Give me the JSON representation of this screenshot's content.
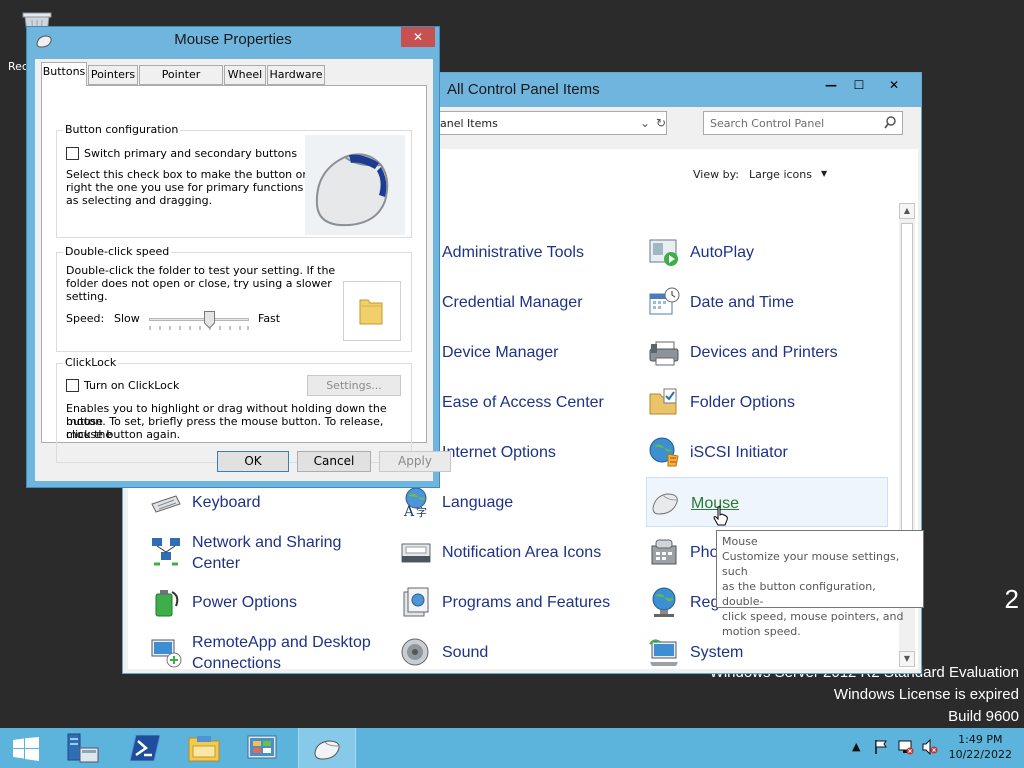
{
  "desktop": {
    "recycle_bin_label": "Rec",
    "watermark": {
      "edition_tail": "2",
      "edition": "Windows Server 2012 R2 Standard Evaluation",
      "license": "Windows License is expired",
      "build": "Build 9600"
    }
  },
  "control_panel": {
    "title": "All Control Panel Items",
    "caption_buttons": {
      "minimize": "—",
      "maximize": "☐",
      "close": "✕"
    },
    "address": "anel Items",
    "search_placeholder": "Search Control Panel",
    "view_by_label": "View by:",
    "view_by_value": "Large icons",
    "items": [
      {
        "label": "Administrative Tools",
        "icon": "admin-tools-icon"
      },
      {
        "label": "AutoPlay",
        "icon": "autoplay-icon"
      },
      {
        "label": "Credential Manager",
        "icon": "credential-manager-icon"
      },
      {
        "label": "Date and Time",
        "icon": "calendar-clock-icon"
      },
      {
        "label": "Device Manager",
        "icon": "device-manager-icon"
      },
      {
        "label": "Devices and Printers",
        "icon": "printer-icon"
      },
      {
        "label": "Ease of Access Center",
        "icon": "ease-of-access-icon"
      },
      {
        "label": "Folder Options",
        "icon": "folder-options-icon"
      },
      {
        "label": "Internet Options",
        "icon": "internet-options-icon"
      },
      {
        "label": "iSCSI Initiator",
        "icon": "iscsi-globe-icon"
      },
      {
        "label": "Keyboard",
        "icon": "keyboard-icon"
      },
      {
        "label": "Language",
        "icon": "language-icon"
      },
      {
        "label": "Mouse",
        "icon": "mouse-icon"
      },
      {
        "label_line1": "Network and Sharing",
        "label_line2": "Center",
        "icon": "network-icon"
      },
      {
        "label": "Notification Area Icons",
        "icon": "notification-area-icon"
      },
      {
        "label": "Pho",
        "icon": "phone-modem-icon"
      },
      {
        "label": "Power Options",
        "icon": "power-options-icon"
      },
      {
        "label": "Programs and Features",
        "icon": "programs-features-icon"
      },
      {
        "label": "Reg",
        "icon": "region-globe-icon"
      },
      {
        "label_line1": "RemoteApp and Desktop",
        "label_line2": "Connections",
        "icon": "remoteapp-icon"
      },
      {
        "label": "Sound",
        "icon": "speaker-icon"
      },
      {
        "label": "System",
        "icon": "system-icon"
      }
    ],
    "tooltip": {
      "title": "Mouse",
      "line1": "Customize your mouse settings, such",
      "line2": "as the button configuration, double-",
      "line3": "click speed, mouse pointers, and",
      "line4": "motion speed."
    }
  },
  "mouse_properties": {
    "title": "Mouse Properties",
    "close_glyph": "✕",
    "tabs": [
      "Buttons",
      "Pointers",
      "Pointer Options",
      "Wheel",
      "Hardware"
    ],
    "active_tab": "Buttons",
    "button_config": {
      "caption": "Button configuration",
      "checkbox_label": "Switch primary and secondary buttons",
      "checked": false,
      "desc1": "Select this check box to make the button on the",
      "desc2": "right the one you use for primary functions such",
      "desc3": "as selecting and dragging."
    },
    "double_click": {
      "caption": "Double-click speed",
      "desc1": "Double-click the folder to test your setting. If the",
      "desc2": "folder does not open or close, try using a slower",
      "desc3": "setting.",
      "speed_label": "Speed:",
      "slow": "Slow",
      "fast": "Fast",
      "slider_fraction": 0.6
    },
    "clicklock": {
      "caption": "ClickLock",
      "checkbox_label": "Turn on ClickLock",
      "checked": false,
      "settings_button": "Settings...",
      "desc1": "Enables you to highlight or drag without holding down the mouse",
      "desc2": "button. To set, briefly press the mouse button. To release, click the",
      "desc3": "mouse button again."
    },
    "buttons": {
      "ok": "OK",
      "cancel": "Cancel",
      "apply": "Apply"
    }
  },
  "taskbar": {
    "apps": [
      "start",
      "server-manager",
      "powershell",
      "file-explorer",
      "control-panel",
      "mouse-properties"
    ],
    "time": "1:49 PM",
    "date": "10/22/2022",
    "tray_icons": [
      "show-hidden-arrow-icon",
      "action-center-flag-icon",
      "network-icon",
      "volume-muted-icon"
    ]
  }
}
